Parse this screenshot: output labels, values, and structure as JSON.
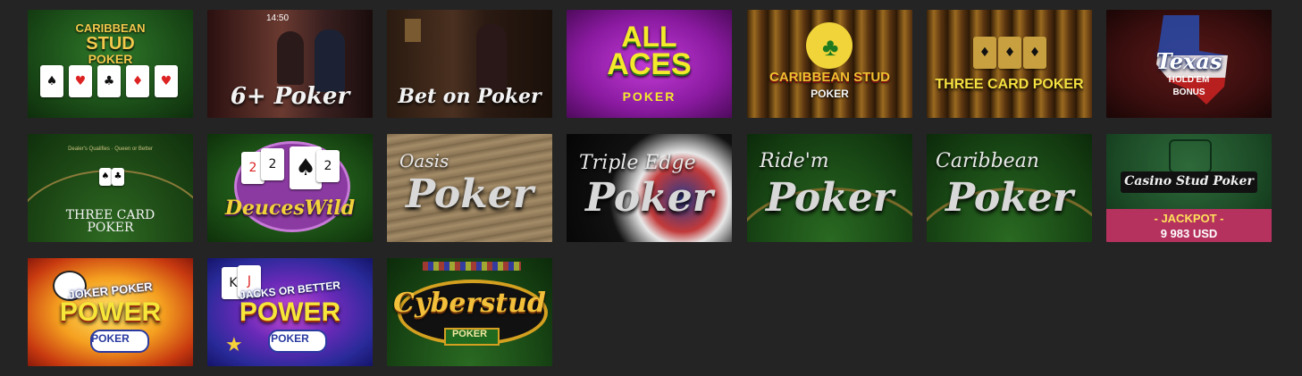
{
  "games": [
    {
      "name": "caribbean-stud-poker-1",
      "title": "CARIBBEAN",
      "title2": "STUD",
      "title3": "POKER"
    },
    {
      "name": "six-plus-poker",
      "title": "6+ Poker",
      "clock": "14:50"
    },
    {
      "name": "bet-on-poker",
      "title": "Bet on Poker"
    },
    {
      "name": "all-aces-poker",
      "title": "ALL",
      "title2": "ACES",
      "title3": "POKER"
    },
    {
      "name": "caribbean-stud-poker-2",
      "title": "CARIBBEAN STUD",
      "title2": "POKER"
    },
    {
      "name": "three-card-poker-1",
      "title": "THREE CARD POKER"
    },
    {
      "name": "texas-holdem-bonus",
      "title": "Texas",
      "title2": "HOLD'EM",
      "title3": "BONUS"
    },
    {
      "name": "three-card-poker-2",
      "title": "THREE CARD",
      "title2": "POKER",
      "felt": "Dealer's Qualifies · Queen or Better"
    },
    {
      "name": "deuces-wild",
      "title": "DeucesWild"
    },
    {
      "name": "oasis-poker",
      "title": "Oasis",
      "title2": "Poker"
    },
    {
      "name": "triple-edge-poker",
      "title": "Triple Edge",
      "title2": "Poker"
    },
    {
      "name": "ride-em-poker",
      "title": "Ride'm",
      "title2": "Poker"
    },
    {
      "name": "caribbean-poker",
      "title": "Caribbean",
      "title2": "Poker"
    },
    {
      "name": "casino-stud-poker",
      "title": "Casino Stud Poker",
      "jackpot_label": "- JACKPOT -",
      "jackpot_value": "9 983 USD"
    },
    {
      "name": "joker-poker-power",
      "title": "JOKER POKER",
      "title2": "POWER",
      "title3": "POKER"
    },
    {
      "name": "jacks-or-better-power",
      "title": "JACKS OR BETTER",
      "title2": "POWER",
      "title3": "POKER"
    },
    {
      "name": "cyberstud-poker",
      "title": "Cyberstud",
      "title2": "POKER"
    }
  ],
  "colors": {
    "background": "#242424",
    "jackpot_bar": "#b5325f",
    "jackpot_label": "#ffe15a"
  }
}
